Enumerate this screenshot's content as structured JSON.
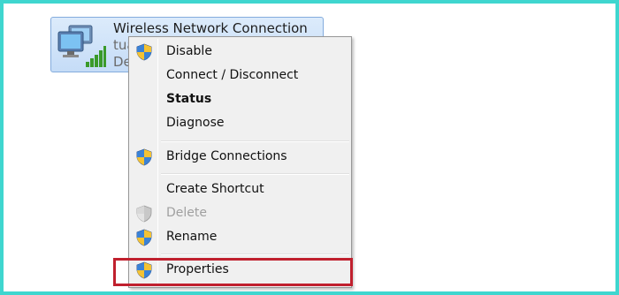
{
  "network_item": {
    "name": "Wireless Network Connection",
    "line2": "tua",
    "line3": "De"
  },
  "context_menu": {
    "items": [
      {
        "label": "Disable",
        "icon": "uac-shield-icon",
        "bold": false,
        "disabled": false
      },
      {
        "label": "Connect / Disconnect",
        "icon": "",
        "bold": false,
        "disabled": false
      },
      {
        "label": "Status",
        "icon": "",
        "bold": true,
        "disabled": false
      },
      {
        "label": "Diagnose",
        "icon": "",
        "bold": false,
        "disabled": false
      },
      {
        "label": "Bridge Connections",
        "icon": "uac-shield-icon",
        "bold": false,
        "disabled": false
      },
      {
        "label": "Create Shortcut",
        "icon": "",
        "bold": false,
        "disabled": false
      },
      {
        "label": "Delete",
        "icon": "uac-shield-icon",
        "bold": false,
        "disabled": true
      },
      {
        "label": "Rename",
        "icon": "uac-shield-icon",
        "bold": false,
        "disabled": false
      },
      {
        "label": "Properties",
        "icon": "uac-shield-icon",
        "bold": false,
        "disabled": false
      }
    ]
  },
  "colors": {
    "frame": "#3fd6cf",
    "highlight": "#c0202e",
    "selection": "#c5dcf7"
  }
}
